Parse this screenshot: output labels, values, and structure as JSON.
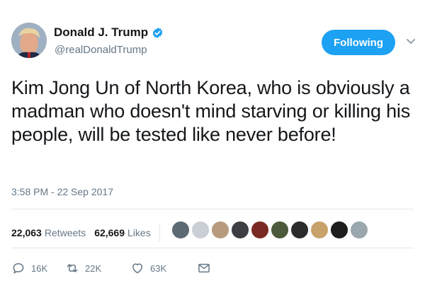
{
  "header": {
    "display_name": "Donald J. Trump",
    "handle": "@realDonaldTrump",
    "follow_label": "Following"
  },
  "tweet": {
    "text": "Kim Jong Un of North Korea, who is obviously a madman who doesn't mind starving or killing his people, will be tested like never before!",
    "timestamp": "3:58 PM - 22 Sep 2017"
  },
  "stats": {
    "retweets_count": "22,063",
    "retweets_label": "Retweets",
    "likes_count": "62,669",
    "likes_label": "Likes"
  },
  "likers": {
    "colors": [
      "#5c6a73",
      "#c9cfd4",
      "#b79b7e",
      "#3c3f44",
      "#7a2a22",
      "#4a5a3a",
      "#2c2c2c",
      "#c9a26b",
      "#1e1e1e",
      "#9aa7ad"
    ]
  },
  "actions": {
    "reply_count": "16K",
    "retweet_count": "22K",
    "like_count": "63K"
  },
  "colors": {
    "accent": "#1da1f2",
    "text": "#14171a",
    "muted": "#657786",
    "divider": "#e1e8ed"
  },
  "icons": [
    "verified-badge-icon",
    "chevron-down-icon",
    "reply-icon",
    "retweet-icon",
    "heart-icon",
    "direct-message-icon"
  ]
}
